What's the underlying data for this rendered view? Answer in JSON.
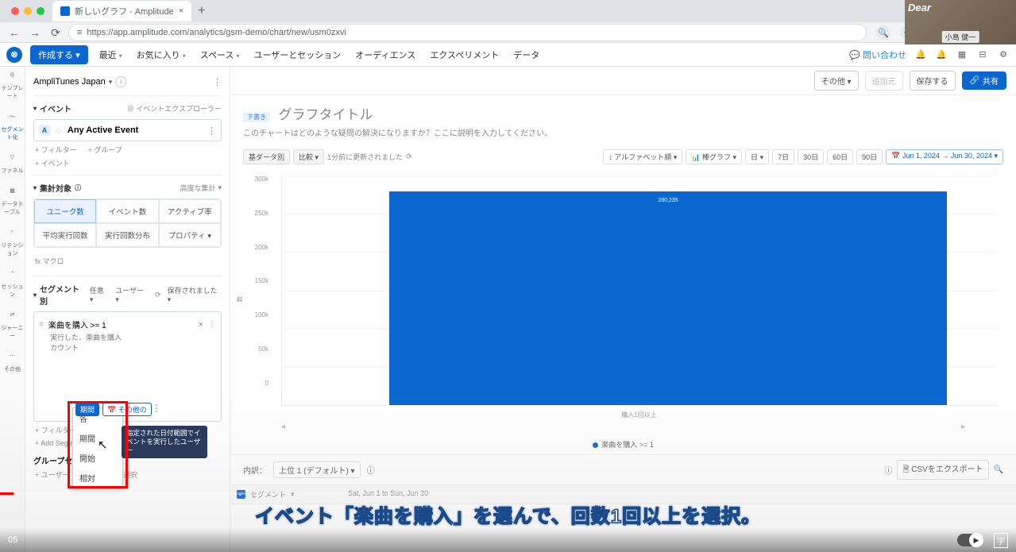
{
  "browser": {
    "tab_title": "新しいグラフ - Amplitude",
    "url": "https://app.amplitude.com/analytics/gsm-demo/chart/new/usm0zxvi"
  },
  "webcam": {
    "brand": "Dear",
    "name": "小島 健一"
  },
  "topnav": {
    "create": "作成する",
    "items": [
      "最近",
      "お気に入り",
      "スペース",
      "ユーザーとセッション",
      "オーディエンス",
      "エクスペリメント",
      "データ"
    ],
    "contact": "問い合わせ"
  },
  "rail": {
    "items": [
      {
        "label": "テンプレート"
      },
      {
        "label": "セグメント化"
      },
      {
        "label": "ファネル"
      },
      {
        "label": "データテーブル"
      },
      {
        "label": "リテンション"
      },
      {
        "label": "セッション"
      },
      {
        "label": "ジャーニー"
      },
      {
        "label": "その他"
      }
    ]
  },
  "sidebar": {
    "project": "AmpliTunes Japan",
    "events": {
      "head": "イベント",
      "explorer": "イベントエクスプローラー",
      "event_a": "Any Active Event",
      "filter": "+ フィルター",
      "group": "+ グループ",
      "add_event": "+ イベント"
    },
    "metrics": {
      "head": "集計対象",
      "advanced": "高度な集計",
      "cells": [
        "ユニーク数",
        "イベント数",
        "アクティブ率",
        "平均実行回数",
        "実行回数分布",
        "プロパティ"
      ],
      "macro": "マクロ"
    },
    "segment": {
      "head": "セグメント別",
      "any": "任意",
      "user": "ユーザー",
      "saved": "保存されました",
      "cond": "楽曲を購入 >= 1",
      "sub": "実行した、楽曲を購入",
      "sub2": "カウント",
      "period_badge": "期間",
      "second_badge": "その他の",
      "filter": "+ フィルター",
      "add_seg": "+ Add Segment",
      "group_head": "グループセグメント",
      "group_user": "+ ユーザー",
      "group_prop": "プロパティを選択"
    },
    "dropdown": {
      "items": [
        "各",
        "期間",
        "開始",
        "相対"
      ],
      "tooltip": "指定された日付範囲でイベントを実行したユーザー"
    }
  },
  "main": {
    "actions": {
      "other": "その他",
      "restore": "追加元",
      "save": "保存する",
      "share": "共有"
    },
    "draft": "下書き",
    "title": "グラフタイトル",
    "desc": "このチャートはどのような疑問の解決になりますか？ここに説明を入力してください。",
    "toolbar": {
      "view": "基ダータ別",
      "compare": "比較",
      "updated": "1分前に更新されました",
      "sort": "アルファベット順",
      "chart_type": "棒グラフ",
      "sum": "日",
      "ranges": [
        "7日",
        "30日",
        "60日",
        "90日"
      ],
      "date": "Jun 1, 2024 → Jun 30, 2024"
    },
    "chart_data": {
      "type": "bar",
      "categories": [
        "購入1回以上"
      ],
      "series": [
        {
          "name": "楽曲を購入 >= 1",
          "values": [
            280000
          ]
        }
      ],
      "ylim": [
        0,
        300000
      ],
      "yticks": [
        "300k",
        "250k",
        "200k",
        "150k",
        "100k",
        "50k",
        "0"
      ],
      "ylabel": "数",
      "xlabel": "購入1回以上",
      "bar_label": "280,235"
    },
    "legend": "楽曲を購入 >= 1",
    "datatable": {
      "breakdown": "内訳：",
      "default": "上位 1 (デフォルト)",
      "export": "CSVをエクスポート",
      "col1": "セグメント",
      "col2": "Sat, Jun 1 to Sun, Jun 30"
    }
  },
  "video": {
    "timecode": "05",
    "subtitle_pre": "イベント",
    "subtitle_hl": "「楽曲を購入」",
    "subtitle_post": "を選んで、回数1回以上を選択。"
  }
}
